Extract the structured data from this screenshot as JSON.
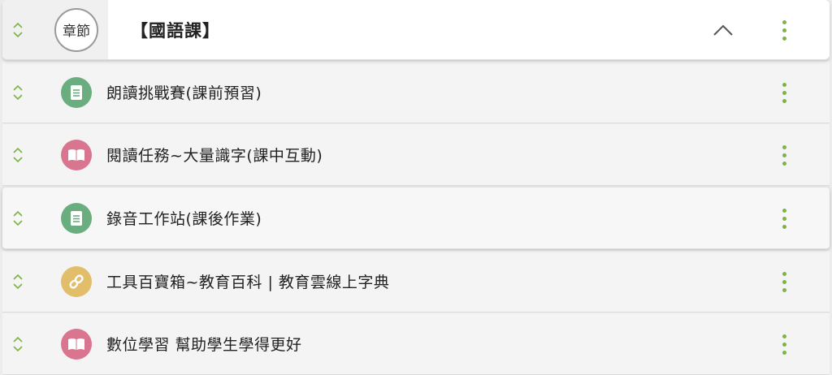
{
  "header": {
    "badge": "章節",
    "title": "【國語課】"
  },
  "items": [
    {
      "label": "朗讀挑戰賽(課前預習)",
      "icon": "document-icon",
      "icon_color": "#6aae7f"
    },
    {
      "label": "閱讀任務~大量識字(課中互動)",
      "icon": "book-icon",
      "icon_color": "#d9758e"
    },
    {
      "label": "錄音工作站(課後作業)",
      "icon": "document-icon",
      "icon_color": "#6aae7f"
    },
    {
      "label": "工具百寶箱~教育百科 | 教育雲線上字典",
      "icon": "link-icon",
      "icon_color": "#e2bd6a"
    },
    {
      "label": "數位學習 幫助學生學得更好",
      "icon": "book-icon",
      "icon_color": "#d9758e"
    }
  ],
  "colors": {
    "accent_green": "#7cb342",
    "chevron": "#666666"
  }
}
